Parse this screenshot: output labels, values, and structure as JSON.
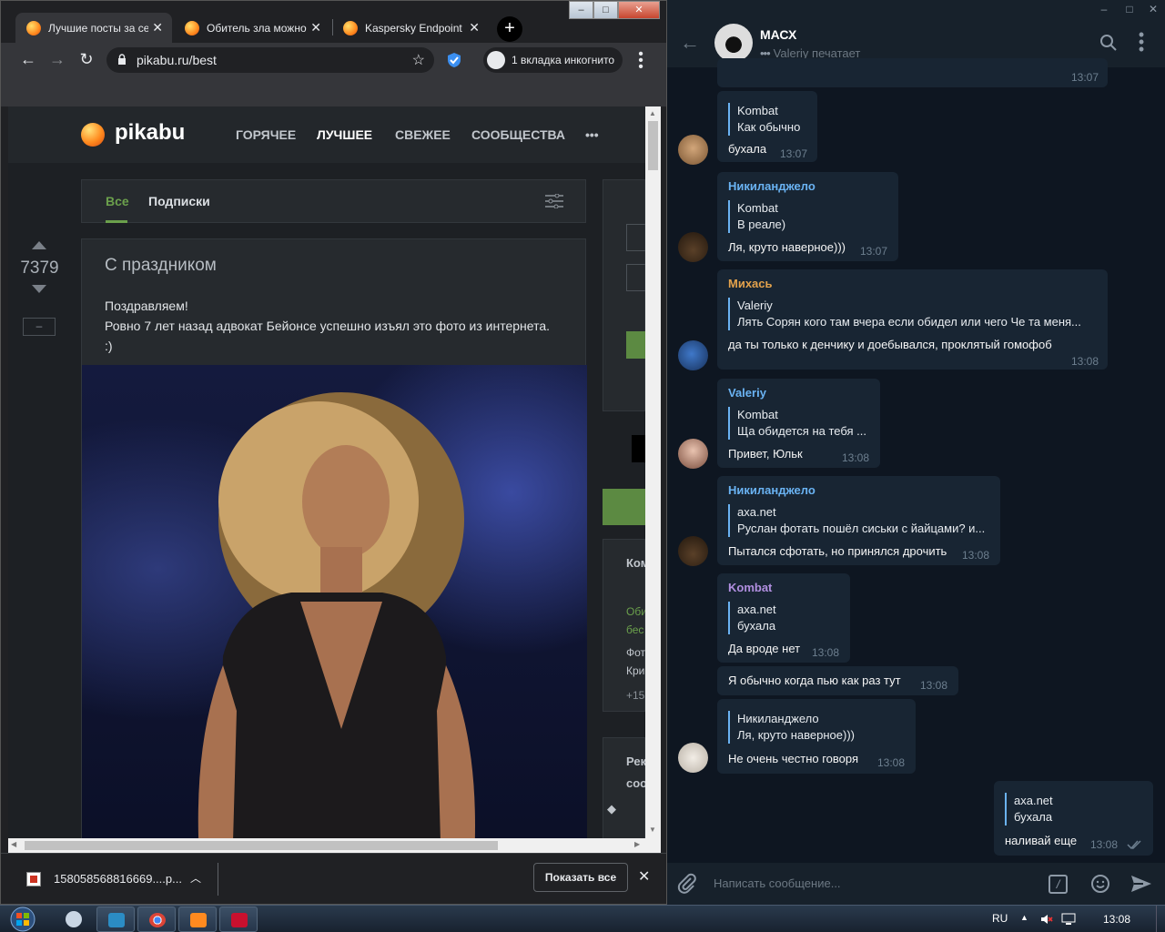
{
  "browser": {
    "tabs": [
      {
        "title": "Лучшие посты за сегодня"
      },
      {
        "title": "Обитель зла можно"
      },
      {
        "title": "Kaspersky Endpoint Security"
      }
    ],
    "url": "pikabu.ru/best",
    "incognito_label": "1 вкладка инкогнито"
  },
  "pikabu": {
    "logo": "pikabu",
    "nav": [
      "ГОРЯЧЕЕ",
      "ЛУЧШЕЕ",
      "СВЕЖЕЕ",
      "СООБЩЕСТВА",
      "•••"
    ],
    "filter_all": "Все",
    "filter_subs": "Подписки",
    "rating": "7379",
    "minus_label": "–",
    "post_title": "С праздником",
    "post_line1": "Поздравляем!",
    "post_line2": "Ровно 7 лет назад адвокат Бейонсе успешно изъял это фото из интернета.",
    "post_line3": ":)",
    "side_texts": [
      "Ком",
      "Оби",
      "бес",
      "Фот",
      "Кри",
      "+15",
      "Рек",
      "соо"
    ]
  },
  "downloads": {
    "file": "158058568816669....p...",
    "show_all": "Показать все"
  },
  "telegram": {
    "chat_name": "МАСХ",
    "status": "Valeriy печатает",
    "input_placeholder": "Написать сообщение...",
    "top_time": "13:07",
    "messages": [
      {
        "quote_name": "Kombat",
        "quote_text": "Как обычно",
        "text": "бухала",
        "time": "13:07"
      },
      {
        "sender": "Никиланджело",
        "quote_name": "Kombat",
        "quote_text": "В реале)",
        "text": "Ля, круто наверное)))",
        "time": "13:07"
      },
      {
        "sender": "Михась",
        "quote_name": "Valeriy",
        "quote_text": "Лять  Сорян кого там вчера если обидел или чего  Че та меня...",
        "text": "да ты только к денчику и доебывался, проклятый гомофоб",
        "time": "13:08"
      },
      {
        "sender": "Valeriy",
        "quote_name": "Kombat",
        "quote_text": "Ща обидется на тебя ...",
        "text": "Привет,  Юльк",
        "time": "13:08"
      },
      {
        "sender": "Никиланджело",
        "quote_name": "axa.net",
        "quote_text": "Руслан фотать пошёл сиськи с йайцами? и...",
        "text": "Пытался сфотать, но принялся дрочить",
        "time": "13:08"
      },
      {
        "sender": "Kombat",
        "quote_name": "axa.net",
        "quote_text": "бухала",
        "text": "Да вроде нет",
        "time": "13:08"
      },
      {
        "text": "Я обычно когда пью как раз тут",
        "time": "13:08"
      },
      {
        "quote_name": "Никиланджело",
        "quote_text": "Ля, круто наверное)))",
        "text": "Не очень честно говоря",
        "time": "13:08"
      },
      {
        "quote_name": "axa.net",
        "quote_text": "бухала",
        "text": "наливай еще",
        "time": "13:08",
        "outgoing": true
      }
    ],
    "sender_colors": {
      "Никиланджело": "#6ab3f3",
      "Михась": "#e3a24c",
      "Valeriy": "#6ab3f3",
      "Kombat": "#b18fe0"
    }
  },
  "taskbar": {
    "lang": "RU",
    "clock": "13:08"
  }
}
